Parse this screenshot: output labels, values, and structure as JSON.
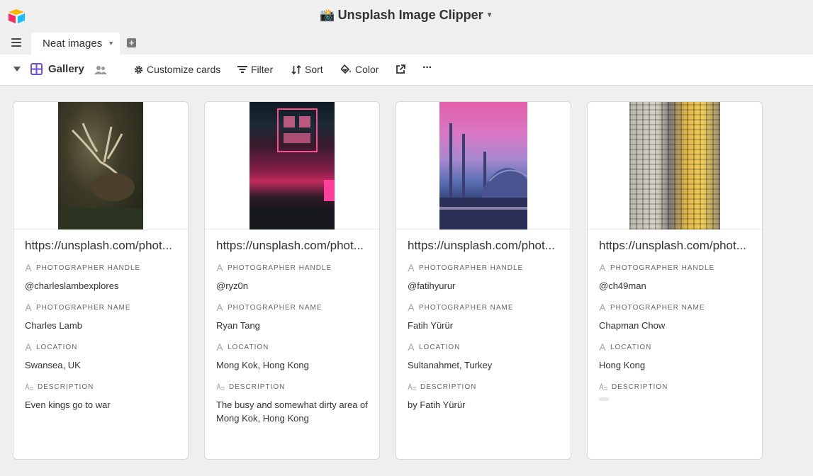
{
  "app": {
    "title": "Unsplash Image Clipper",
    "camera_glyph": "📸"
  },
  "tabs": [
    {
      "label": "Neat images"
    }
  ],
  "toolbar": {
    "view_name": "Gallery",
    "customize": "Customize cards",
    "filter": "Filter",
    "sort": "Sort",
    "color": "Color",
    "more": "···"
  },
  "labels": {
    "handle": "PHOTOGRAPHER HANDLE",
    "name": "PHOTOGRAPHER NAME",
    "location": "LOCATION",
    "description": "DESCRIPTION"
  },
  "cards": [
    {
      "title": "https://unsplash.com/phot...",
      "handle": "@charleslambexplores",
      "name": "Charles Lamb",
      "location": "Swansea, UK",
      "description": "Even kings go to war"
    },
    {
      "title": "https://unsplash.com/phot...",
      "handle": "@ryz0n",
      "name": "Ryan Tang",
      "location": "Mong Kok, Hong Kong",
      "description": "The busy and somewhat dirty area of Mong Kok, Hong Kong"
    },
    {
      "title": "https://unsplash.com/phot...",
      "handle": "@fatihyurur",
      "name": "Fatih Yürür",
      "location": "Sultanahmet, Turkey",
      "description": "by Fatih Yürür"
    },
    {
      "title": "https://unsplash.com/phot...",
      "handle": "@ch49man",
      "name": "Chapman Chow",
      "location": "Hong Kong",
      "description": ""
    }
  ],
  "colors": {
    "accent_purple": "#6d4fd8",
    "background": "#efefef",
    "card": "#ffffff"
  }
}
